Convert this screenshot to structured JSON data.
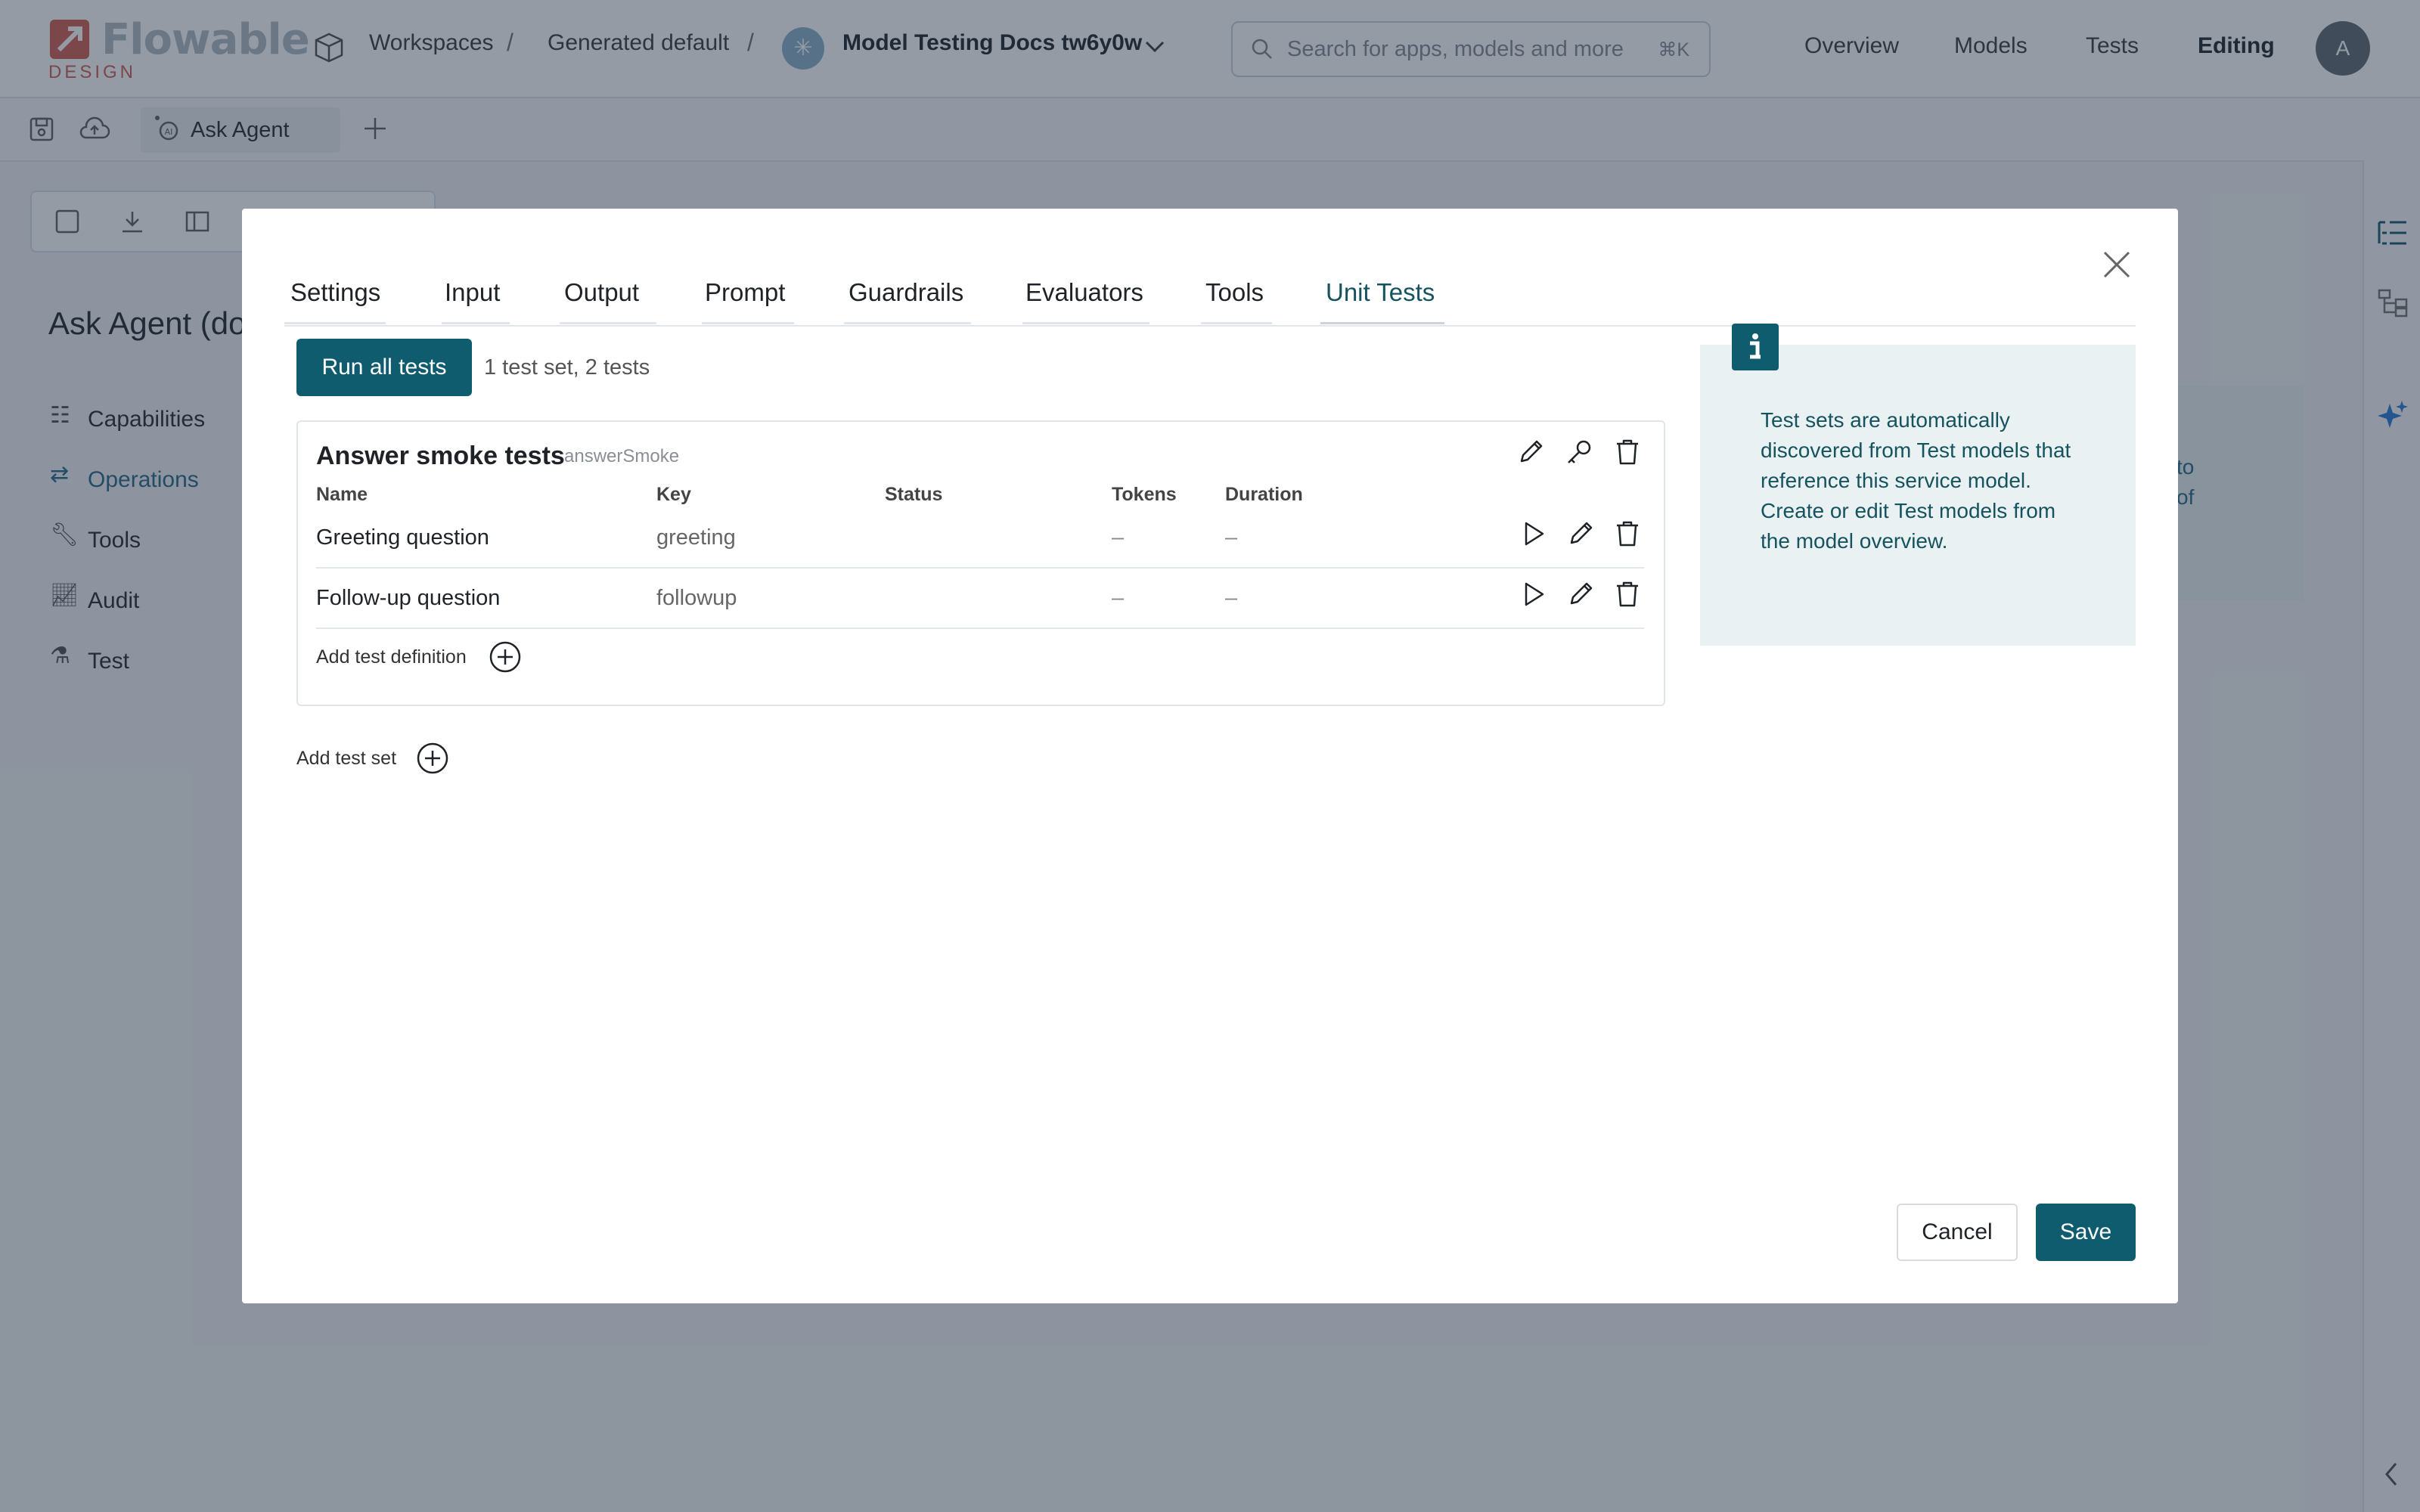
{
  "header": {
    "logo_text": "Flowable",
    "logo_sub": "DESIGN",
    "breadcrumb": [
      "Workspaces",
      "Generated default"
    ],
    "app_name": "Model Testing Docs tw6y0w",
    "search_placeholder": "Search for apps, models and more",
    "search_shortcut": "⌘K",
    "nav": [
      "Overview",
      "Models",
      "Tests",
      "Editing"
    ],
    "user_initial": "A"
  },
  "doc_tab": {
    "label": "Ask Agent"
  },
  "editor": {
    "title": "Ask Agent (do",
    "sidebar": [
      "Capabilities",
      "Operations",
      "Tools",
      "Audit",
      "Test"
    ],
    "bg_card_text": [
      "to",
      "of"
    ]
  },
  "modal": {
    "tabs": [
      "Settings",
      "Input",
      "Output",
      "Prompt",
      "Guardrails",
      "Evaluators",
      "Tools",
      "Unit Tests"
    ],
    "active_tab": "Unit Tests",
    "run_all_label": "Run all tests",
    "summary": "1 test set, 2 tests",
    "test_set": {
      "name": "Answer smoke tests",
      "key": "answerSmoke",
      "columns": [
        "Name",
        "Key",
        "Status",
        "Tokens",
        "Duration"
      ],
      "rows": [
        {
          "name": "Greeting question",
          "key": "greeting",
          "status": "",
          "tokens": "–",
          "duration": "–"
        },
        {
          "name": "Follow-up question",
          "key": "followup",
          "status": "",
          "tokens": "–",
          "duration": "–"
        }
      ],
      "add_definition_label": "Add test definition"
    },
    "add_set_label": "Add test set",
    "info_text": "Test sets are automatically discovered from Test models that reference this service model. Create or edit Test models from the model overview.",
    "cancel_label": "Cancel",
    "save_label": "Save"
  },
  "colors": {
    "primary": "#0f5c6e",
    "info_bg": "#e9f1f3",
    "overlay": "#16263a"
  }
}
